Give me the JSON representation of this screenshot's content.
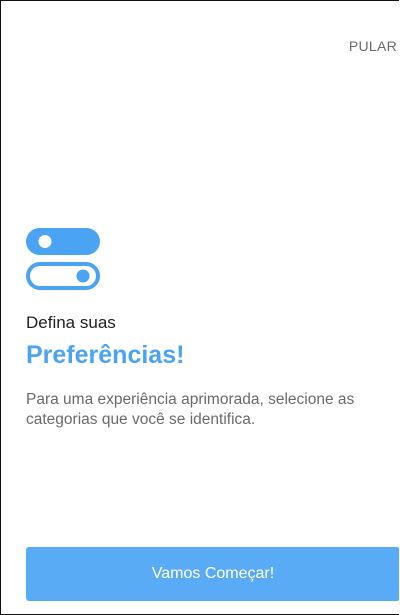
{
  "header": {
    "skip_label": "PULAR"
  },
  "intro": {
    "icon": "toggle-switches-icon",
    "subtitle": "Defina suas",
    "title": "Preferências!",
    "description": "Para uma experiência aprimorada, selecione as categorias que você se identifica."
  },
  "actions": {
    "start_label": "Vamos Começar!"
  },
  "colors": {
    "accent": "#4ba3f3",
    "button": "#5aabf5",
    "muted_text": "#6a6a6a"
  }
}
